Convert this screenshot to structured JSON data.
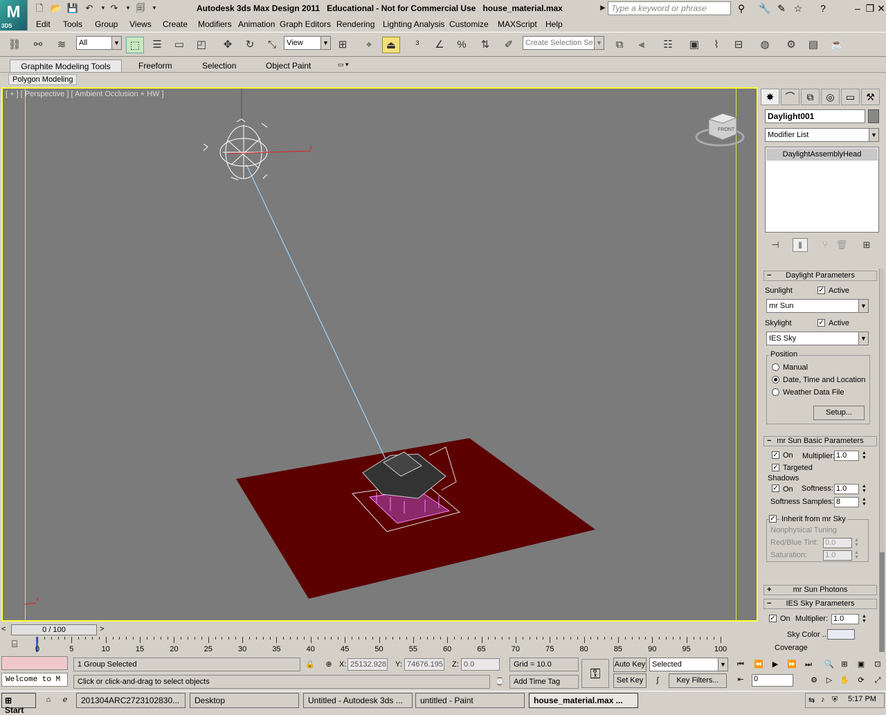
{
  "window": {
    "title": "Autodesk 3ds Max Design 2011   Educational - Not for Commercial Use   house_material.max",
    "search_placeholder": "Type a keyword or phrase",
    "logo_text": "3DS"
  },
  "menubar": [
    "Edit",
    "Tools",
    "Group",
    "Views",
    "Create",
    "Modifiers",
    "Animation",
    "Graph Editors",
    "Rendering",
    "Lighting Analysis",
    "Customize",
    "MAXScript",
    "Help"
  ],
  "main_toolbar": {
    "selection_filter": "All",
    "ref_coord": "View",
    "named_selection_placeholder": "Create Selection Se"
  },
  "ribbon": {
    "tabs": [
      "Graphite Modeling Tools",
      "Freeform",
      "Selection",
      "Object Paint"
    ],
    "active_tab": "Graphite Modeling Tools",
    "panel": "Polygon Modeling"
  },
  "viewport": {
    "label": "[ + ] [ Perspective ] [ Ambient Occlusion + HW ]",
    "viewcube": "FRONT",
    "axis_x": "x",
    "ground_color": "#5c0000",
    "background_color": "#7b7b7b",
    "active_border_color": "#ffff33"
  },
  "command_panel": {
    "object_name": "Daylight001",
    "modifier_list": "Modifier List",
    "stack_item": "DaylightAssemblyHead",
    "daylight_params": {
      "header": "Daylight Parameters",
      "sunlight_label": "Sunlight",
      "sunlight_active_label": "Active",
      "sunlight_type": "mr Sun",
      "skylight_label": "Skylight",
      "skylight_active_label": "Active",
      "skylight_type": "IES Sky",
      "position_label": "Position",
      "manual": "Manual",
      "date_time": "Date, Time and Location",
      "weather": "Weather Data File",
      "setup_button": "Setup..."
    },
    "mr_sun_basic": {
      "header": "mr Sun Basic Parameters",
      "on": "On",
      "multiplier_label": "Multiplier:",
      "multiplier": "1.0",
      "targeted": "Targeted",
      "shadows_label": "Shadows",
      "shadow_on": "On",
      "softness_label": "Softness:",
      "softness": "1.0",
      "softness_samples_label": "Softness Samples:",
      "softness_samples": "8",
      "inherit": "Inherit from mr Sky",
      "nonphysical": "Nonphysical Tuning",
      "red_blue_label": "Red/Blue Tint:",
      "red_blue": "0.0",
      "saturation_label": "Saturation:",
      "saturation": "1.0"
    },
    "mr_sun_photons": {
      "header": "mr Sun Photons"
    },
    "ies_sky": {
      "header": "IES Sky Parameters",
      "on": "On",
      "multiplier_label": "Multiplier:",
      "multiplier": "1.0",
      "sky_color_label": "Sky Color ...",
      "coverage_label": "Coverage"
    }
  },
  "timeline": {
    "slider": "0 / 100",
    "ticks": [
      "0",
      "5",
      "10",
      "15",
      "20",
      "25",
      "30",
      "35",
      "40",
      "45",
      "50",
      "55",
      "60",
      "65",
      "70",
      "75",
      "80",
      "85",
      "90",
      "95",
      "100"
    ]
  },
  "status": {
    "maxscript": "Welcome to M",
    "selection": "1 Group Selected",
    "prompt": "Click or click-and-drag to select objects",
    "x_label": "X:",
    "x_value": "25132.928",
    "y_label": "Y:",
    "y_value": "74676.195",
    "z_label": "Z:",
    "z_value": "0.0",
    "grid": "Grid = 10.0",
    "add_time_tag": "Add Time Tag",
    "auto_key": "Auto Key",
    "set_key": "Set Key",
    "key_mode": "Selected",
    "key_filters": "Key Filters...",
    "frame": "0"
  },
  "taskbar": {
    "start": "Start",
    "tasks": [
      "201304ARC2723102830...",
      "Desktop",
      "Untitled - Autodesk 3ds ...",
      "untitled - Paint",
      "house_material.max ..."
    ],
    "active_index": 4,
    "clock": "5:17 PM"
  }
}
